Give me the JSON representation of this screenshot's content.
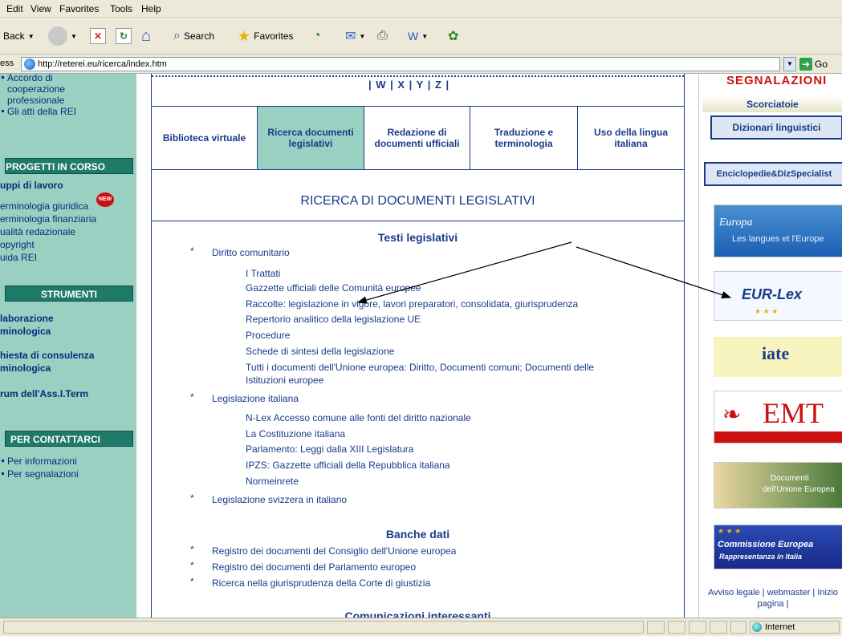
{
  "menu": [
    "Edit",
    "View",
    "Favorites",
    "Tools",
    "Help"
  ],
  "toolbar": {
    "back": "Back",
    "search": "Search",
    "favorites": "Favorites"
  },
  "address": {
    "label": "ess",
    "url": "http://reterei.eu/ricerca/index.htm",
    "go": "Go"
  },
  "left": {
    "top_items": [
      "Accordo di",
      "cooperazione",
      "professionale",
      "Gli atti della REI"
    ],
    "progetti_header": "PROGETTI IN CORSO",
    "gruppi": "uppi di lavoro",
    "progetti": [
      "erminologia giuridica",
      "erminologia finanziaria",
      "ualità redazionale",
      "opyright",
      "uida REI"
    ],
    "new_badge": "NEW",
    "strumenti_header": "STRUMENTI",
    "strumenti": [
      "laborazione",
      "minologica",
      "hiesta di consulenza",
      "minologica",
      "rum dell'Ass.I.Term"
    ],
    "contatti_header": "PER CONTATTARCI",
    "contatti": [
      "Per informazioni",
      "Per segnalazioni"
    ]
  },
  "main": {
    "alphabet": "| W | X | Y | Z |",
    "tabs": [
      {
        "label": "Biblioteca virtuale"
      },
      {
        "label": "Ricerca documenti legislativi"
      },
      {
        "label": "Redazione di documenti ufficiali"
      },
      {
        "label": "Traduzione e terminologia"
      },
      {
        "label": "Uso della lingua italiana"
      }
    ],
    "title": "RICERCA DI DOCUMENTI LEGISLATIVI",
    "testi_title": "Testi legislativi",
    "diritto": "Diritto comunitario",
    "diritto_sub": [
      "I Trattati",
      "Gazzette ufficiali delle Comunità europee",
      "Raccolte: legislazione in vigore, lavori preparatori, consolidata, giurisprudenza",
      "Repertorio analitico della legislazione UE",
      "Procedure",
      "Schede di sintesi della legislazione",
      "Tutti i documenti dell'Unione europea: Diritto, Documenti comuni; Documenti delle",
      "Istituzioni europee"
    ],
    "italiana": "Legislazione italiana",
    "italiana_sub": [
      "N-Lex Accesso comune alle fonti  del diritto nazionale",
      "La Costituzione italiana",
      "Parlamento: Leggi dalla XIII Legislatura",
      "IPZS: Gazzette ufficiali della Repubblica italiana",
      "Normeinrete"
    ],
    "svizzera": "Legislazione svizzera in italiano",
    "banche_title": "Banche dati",
    "banche": [
      "Registro dei documenti del Consiglio dell'Unione europea",
      "Registro dei documenti del Parlamento europeo",
      "Ricerca nella giurisprudenza della Corte di giustizia"
    ],
    "bottom_partial": "Comunicazioni interessanti",
    "star": "*"
  },
  "right": {
    "segnalazioni": "SEGNALAZIONI",
    "scorciatoie": "Scorciatoie",
    "dizionari": "Dizionari linguistici",
    "enciclopedie": "Enciclopedie&DizSpecialist",
    "europa_logo": "Europa",
    "europa_sub": "Les langues et l'Europe",
    "eurlex": "EUR-Lex",
    "iate": "iate",
    "emt": "EMT",
    "documenti_1": "Documenti",
    "documenti_2": "dell'Unione Europea",
    "commissione_1": "Commissione Europea",
    "commissione_2": "Rappresentanza in Italia",
    "footer": "Avviso legale | webmaster | Inizio pagina |"
  },
  "status": {
    "zone": "Internet"
  },
  "colors": {
    "teal": "#9ad0c2",
    "navy": "#1a3a8a",
    "red": "#cc1010"
  }
}
